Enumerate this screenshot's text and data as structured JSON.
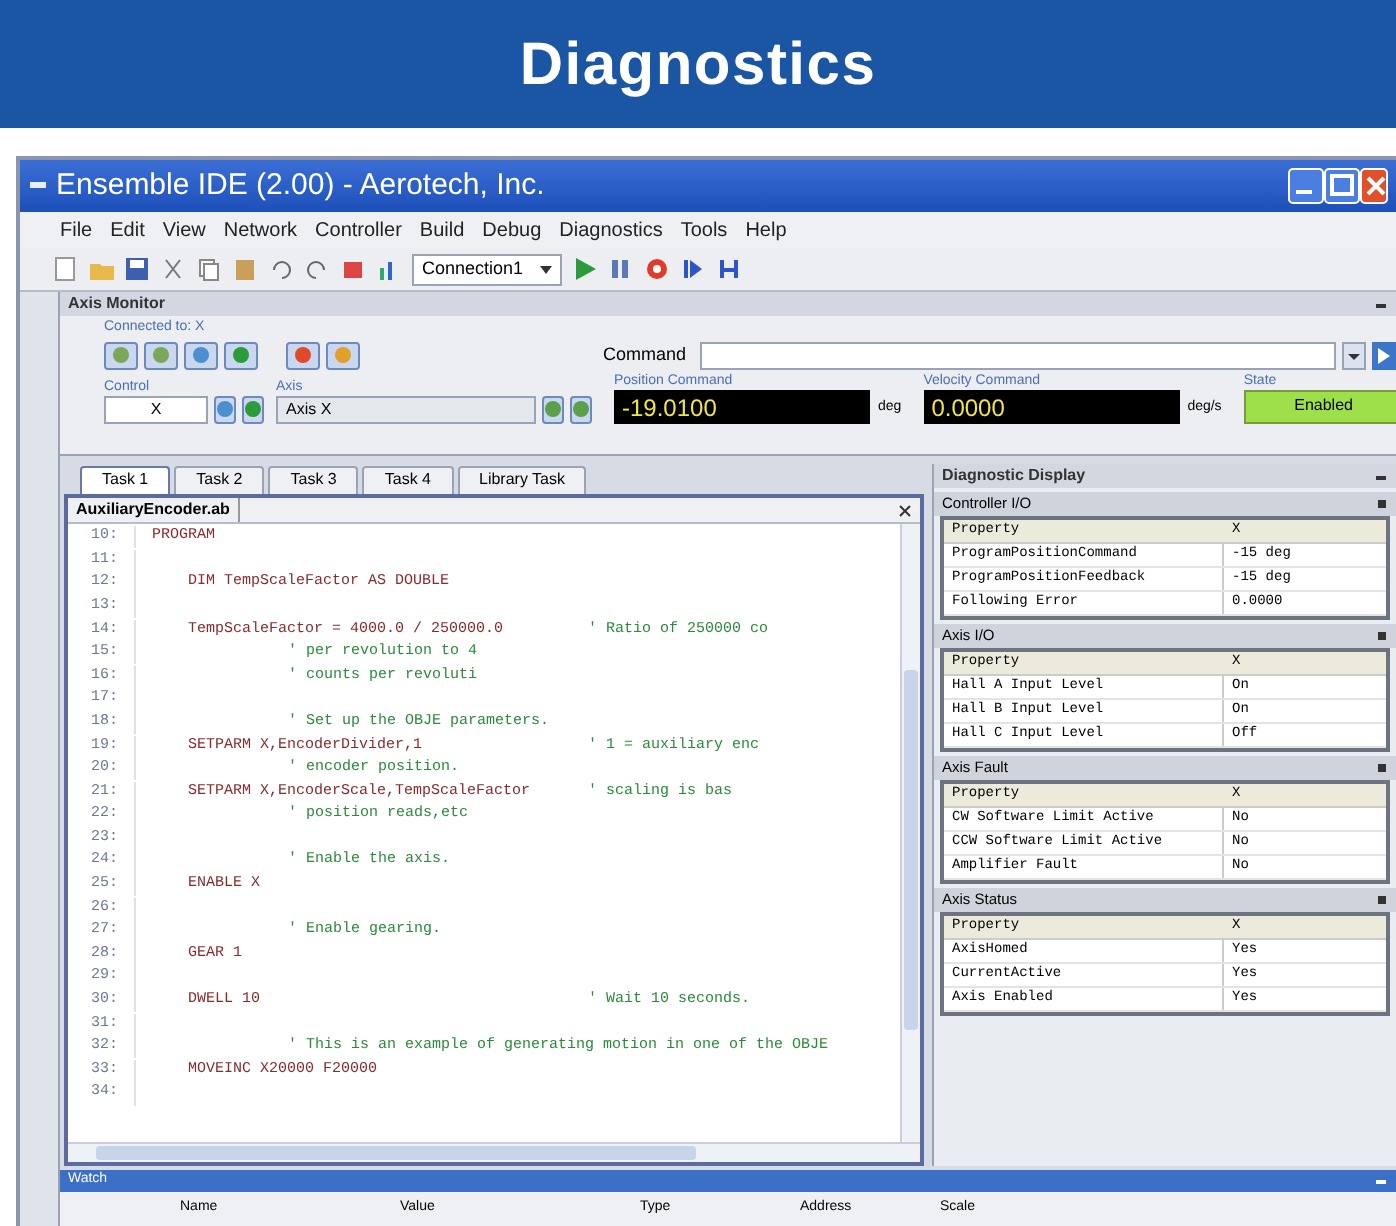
{
  "banner": {
    "title": "Diagnostics"
  },
  "window": {
    "title": "Ensemble IDE (2.00) - Aerotech, Inc."
  },
  "menu": [
    "File",
    "Edit",
    "View",
    "Network",
    "Controller",
    "Build",
    "Debug",
    "Diagnostics",
    "Tools",
    "Help"
  ],
  "toolbar": {
    "connection": "Connection1"
  },
  "axis_monitor": {
    "title": "Axis Monitor",
    "subtitle": "Connected to: X",
    "command_label": "Command",
    "control_label": "Control",
    "control_value": "X",
    "axis_label": "Axis",
    "axis_value": "Axis X",
    "readouts": [
      {
        "label": "Position Command",
        "value": "-19.0100",
        "unit": "deg"
      },
      {
        "label": "Velocity Command",
        "value": "0.0000",
        "unit": "deg/s"
      }
    ],
    "state_label": "State",
    "state": "Enabled",
    "enabled": true
  },
  "tabs": [
    {
      "label": "Task 1",
      "selected": true
    },
    {
      "label": "Task 2",
      "selected": false
    },
    {
      "label": "Task 3",
      "selected": false
    },
    {
      "label": "Task 4",
      "selected": false
    },
    {
      "label": "Library Task",
      "selected": false
    }
  ],
  "editor": {
    "file": "AuxiliaryEncoder.ab",
    "lines": [
      {
        "num": "10:",
        "code": "PROGRAM"
      },
      {
        "num": "11:"
      },
      {
        "num": "12:",
        "code": "    DIM TempScaleFactor AS DOUBLE"
      },
      {
        "num": "13:"
      },
      {
        "num": "14:",
        "code": "    TempScaleFactor = 4000.0 / 250000.0",
        "comment": "' Ratio of 250000 co"
      },
      {
        "num": "15:",
        "comment": "' per revolution to 4"
      },
      {
        "num": "16:",
        "comment": "' counts per revoluti"
      },
      {
        "num": "17:"
      },
      {
        "num": "18:",
        "comment": "' Set up the OBJE parameters."
      },
      {
        "num": "19:",
        "code": "    SETPARM X,EncoderDivider,1",
        "comment": "' 1 = auxiliary enc"
      },
      {
        "num": "20:",
        "comment": "' encoder position."
      },
      {
        "num": "21:",
        "code": "    SETPARM X,EncoderScale,TempScaleFactor",
        "comment": "' scaling is bas"
      },
      {
        "num": "22:",
        "comment": "' position reads,etc"
      },
      {
        "num": "23:"
      },
      {
        "num": "24:",
        "comment": "' Enable the axis."
      },
      {
        "num": "25:",
        "code": "    ENABLE X"
      },
      {
        "num": "26:"
      },
      {
        "num": "27:",
        "comment": "' Enable gearing."
      },
      {
        "num": "28:",
        "code": "    GEAR 1"
      },
      {
        "num": "29:"
      },
      {
        "num": "30:",
        "code": "    DWELL 10",
        "comment": "' Wait 10 seconds."
      },
      {
        "num": "31:"
      },
      {
        "num": "32:",
        "comment": "' This is an example of generating motion in one of the OBJE"
      },
      {
        "num": "33:",
        "code": "    MOVEINC X20000 F20000"
      },
      {
        "num": "34:"
      }
    ]
  },
  "diagnostics": {
    "title": "Diagnostic Display",
    "sections": [
      {
        "title": "Controller I/O",
        "header": [
          "Property",
          "X"
        ],
        "rows": [
          [
            "ProgramPositionCommand",
            "-15 deg"
          ],
          [
            "ProgramPositionFeedback",
            "-15 deg"
          ],
          [
            "Following Error",
            "0.0000"
          ]
        ]
      },
      {
        "title": "Axis I/O",
        "header": [
          "Property",
          "X"
        ],
        "rows": [
          [
            "Hall A Input Level",
            "On"
          ],
          [
            "Hall B Input Level",
            "On"
          ],
          [
            "Hall C Input Level",
            "Off"
          ]
        ]
      },
      {
        "title": "Axis Fault",
        "header": [
          "Property",
          "X"
        ],
        "rows": [
          [
            "CW Software Limit Active",
            "No"
          ],
          [
            "CCW Software Limit Active",
            "No"
          ],
          [
            "Amplifier Fault",
            "No"
          ]
        ]
      },
      {
        "title": "Axis Status",
        "header": [
          "Property",
          "X"
        ],
        "rows": [
          [
            "AxisHomed",
            "Yes"
          ],
          [
            "CurrentActive",
            "Yes"
          ],
          [
            "Axis Enabled",
            "Yes"
          ]
        ]
      }
    ]
  },
  "watch": {
    "title": "Watch",
    "columns": [
      "Name",
      "Value",
      "Type",
      "Address",
      "Scale"
    ]
  }
}
